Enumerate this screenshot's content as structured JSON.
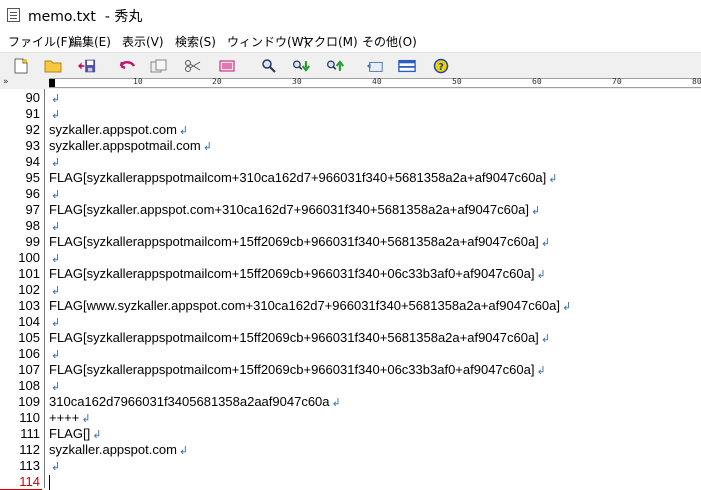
{
  "window": {
    "title": "memo.txt  - 秀丸"
  },
  "menu": [
    "ファイル(F)",
    "編集(E)",
    "表示(V)",
    "検索(S)",
    "ウィンドウ(W)",
    "マクロ(M)",
    "その他(O)"
  ],
  "toolbar": {
    "icons": [
      "new-file-icon",
      "open-folder-icon",
      "save-icon",
      "undo-icon",
      "copy-icon",
      "cut-icon",
      "paste-icon",
      "find-icon",
      "find-next-down-icon",
      "find-next-up-icon",
      "grep-icon",
      "split-window-icon",
      "help-icon"
    ]
  },
  "ruler": {
    "chevron": "»",
    "marks": [
      "10",
      "20",
      "30",
      "40",
      "50",
      "60",
      "70",
      "80"
    ]
  },
  "editor": {
    "eol_symbol": "↲",
    "current_line": 114,
    "lines": [
      {
        "n": "90",
        "text": ""
      },
      {
        "n": "91",
        "text": ""
      },
      {
        "n": "92",
        "text": "syzkaller.appspot.com"
      },
      {
        "n": "93",
        "text": "syzkaller.appspotmail.com"
      },
      {
        "n": "94",
        "text": ""
      },
      {
        "n": "95",
        "text": "FLAG[syzkallerappspotmailcom+310ca162d7+966031f340+5681358a2a+af9047c60a]"
      },
      {
        "n": "96",
        "text": ""
      },
      {
        "n": "97",
        "text": "FLAG[syzkaller.appspot.com+310ca162d7+966031f340+5681358a2a+af9047c60a]"
      },
      {
        "n": "98",
        "text": ""
      },
      {
        "n": "99",
        "text": "FLAG[syzkallerappspotmailcom+15ff2069cb+966031f340+5681358a2a+af9047c60a]"
      },
      {
        "n": "100",
        "text": ""
      },
      {
        "n": "101",
        "text": "FLAG[syzkallerappspotmailcom+15ff2069cb+966031f340+06c33b3af0+af9047c60a]"
      },
      {
        "n": "102",
        "text": ""
      },
      {
        "n": "103",
        "text": "FLAG[www.syzkaller.appspot.com+310ca162d7+966031f340+5681358a2a+af9047c60a]"
      },
      {
        "n": "104",
        "text": ""
      },
      {
        "n": "105",
        "text": "FLAG[syzkallerappspotmailcom+15ff2069cb+966031f340+5681358a2a+af9047c60a]"
      },
      {
        "n": "106",
        "text": ""
      },
      {
        "n": "107",
        "text": "FLAG[syzkallerappspotmailcom+15ff2069cb+966031f340+06c33b3af0+af9047c60a]"
      },
      {
        "n": "108",
        "text": ""
      },
      {
        "n": "109",
        "text": "310ca162d7966031f3405681358a2aaf9047c60a"
      },
      {
        "n": "110",
        "text": "++++"
      },
      {
        "n": "111",
        "text": "FLAG[]"
      },
      {
        "n": "112",
        "text": "syzkaller.appspot.com"
      },
      {
        "n": "113",
        "text": ""
      },
      {
        "n": "114",
        "text": ""
      }
    ]
  }
}
